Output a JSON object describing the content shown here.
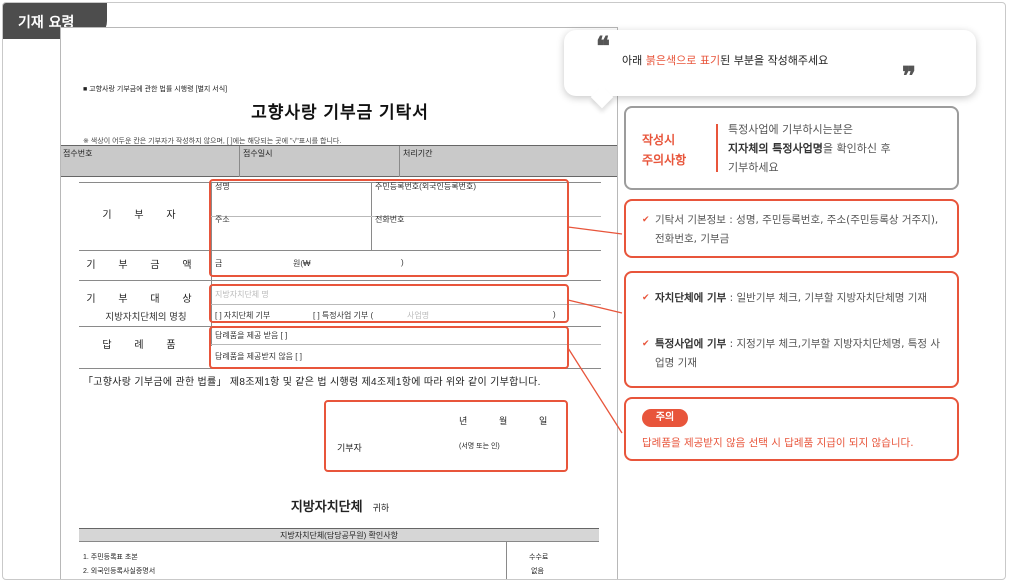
{
  "tab": {
    "label": "기재 요령"
  },
  "doc": {
    "legal_note": "■ 고향사랑 기부금에 관한 법률 시행령 [별지 서식]",
    "title": "고향사랑 기부금 기탁서",
    "instruction": "※ 색상이 어두운 칸은 기부자가 작성하지 않으며, [ ]에는 해당되는 곳에 \"√\"표시를 합니다.",
    "header": {
      "receipt_no": "접수번호",
      "receipt_date": "접수일시",
      "processing": "처리기간"
    },
    "donor": {
      "label": "기 부 자",
      "name": "성명",
      "resident_no": "주민등록번호(외국인등록번호)",
      "address": "주소",
      "phone": "전화번호"
    },
    "amount": {
      "label": "기 부 금 액",
      "prefix": "금",
      "unit": "원(₩",
      "close": ")"
    },
    "target": {
      "label1": "기 부 대 상",
      "label2": "지방자치단체의 명칭",
      "gov_placeholder": "지방자치단체 명",
      "general": "[ ] 자치단체 기부",
      "specific": "[ ] 특정사업 기부 (",
      "project_placeholder": "사업명",
      "close": ")"
    },
    "gift": {
      "label": "답 례 품",
      "receive": "답례품을 제공 받음 [ ]",
      "not_receive": "답례품을 제공받지 않음 [ ]"
    },
    "statement": "「고향사랑 기부금에 관한 법률」 제8조제1항 및 같은 법 시행령 제4조제1항에 따라 위와 같이 기부합니다.",
    "sign": {
      "year": "년",
      "month": "월",
      "day": "일",
      "donor": "기부자",
      "sign_note": "(서명 또는 인)"
    },
    "gov": {
      "name": "지방자치단체",
      "suffix": "귀하"
    },
    "bottom": {
      "header": "지방자치단체(담당공무원) 확인사항",
      "row1": "1. 주민등록표 초본",
      "row2": "2. 외국인등록사실증명서",
      "fee_label": "수수료",
      "fee_value": "없음"
    }
  },
  "bubble": {
    "open_quote": "❝",
    "close_quote": "❞",
    "text_pre": "아래 ",
    "text_highlight": "붉은색으로 표기",
    "text_post": "된 부분을 작성해주세요"
  },
  "caution": {
    "title_line1": "작성시",
    "title_line2": "주의사항",
    "text_pre": "특정사업에 기부하시는분은",
    "text_bold": "지자체의 특정사업명",
    "text_mid": "을 확인하신 후",
    "text_post": "기부하세요"
  },
  "info1": {
    "bullet": "✔",
    "text": "기탁서 기본정보 : 성명, 주민등록번호, 주소(주민등록상 거주지), 전화번호, 기부금"
  },
  "info2": {
    "bullet": "✔",
    "b1_bold": "자치단체에 기부",
    "b1_text": " : 일반기부 체크, 기부할 지방자치단체명 기재",
    "b2_bold": "특정사업에 기부",
    "b2_text": " : 지정기부 체크,기부할 지방자치단체명, 특정 사업명 기재"
  },
  "warning": {
    "badge": "주의",
    "text": "답례품을 제공받지 않음 선택 시 답례품 지급이 되지 않습니다."
  },
  "colors": {
    "accent": "#e8553b",
    "tab_bg": "#4d4d4d",
    "header_gray": "#c9c9c9"
  }
}
